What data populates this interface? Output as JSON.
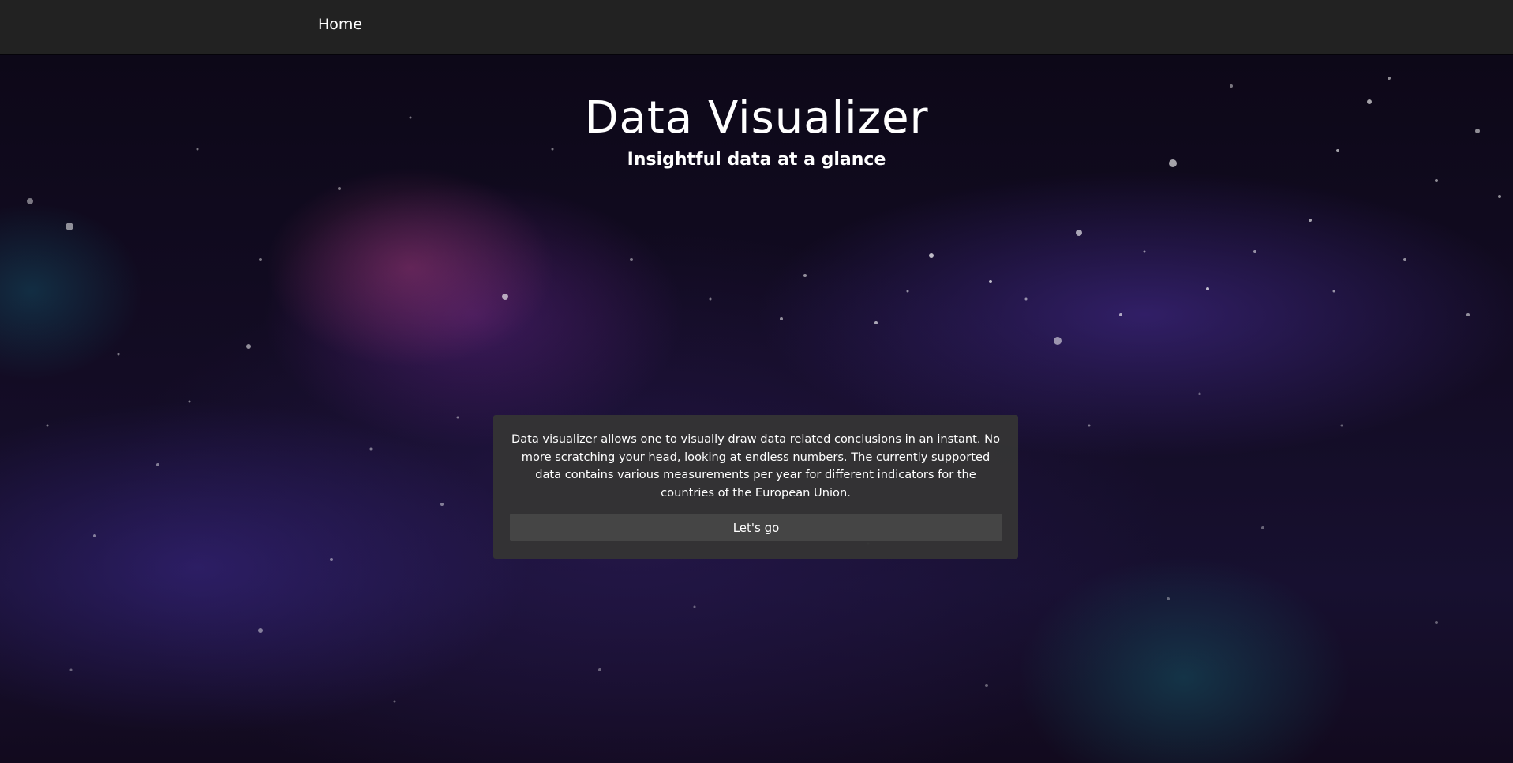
{
  "nav": {
    "home_label": "Home"
  },
  "hero": {
    "title": "Data Visualizer",
    "subtitle": "Insightful data at a glance"
  },
  "card": {
    "description": "Data visualizer allows one to visually draw data related conclusions in an instant. No more scratching your head, looking at endless numbers. The currently supported data contains various measurements per year for different indicators for the countries of the European Union.",
    "button_label": "Let's go"
  },
  "colors": {
    "navbar_background": "#222222",
    "card_background": "#343434",
    "button_background": "#454545",
    "text": "#ffffff"
  }
}
